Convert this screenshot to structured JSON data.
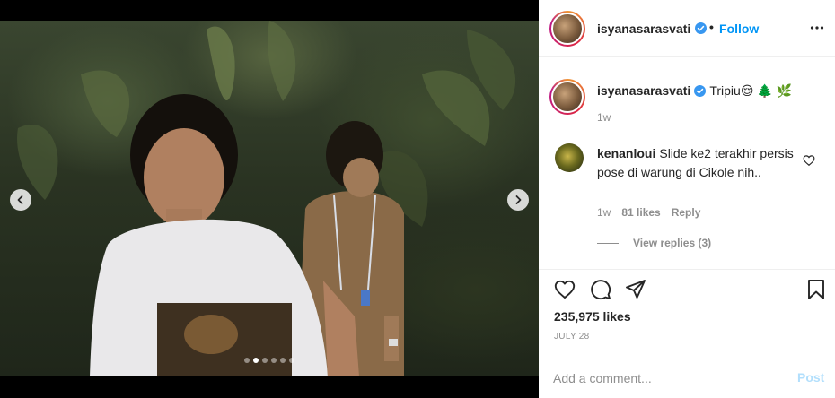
{
  "post": {
    "username": "isyanasarasvati",
    "header_sep": "•",
    "follow_label": "Follow",
    "caption_text": "Tripiu",
    "caption_emojis": "😌 🌲 🌿",
    "caption_time": "1w"
  },
  "comment": {
    "username": "kenanloui",
    "text": "Slide ke2 terakhir persis pose di warung di Cikole nih..",
    "time": "1w",
    "likes": "81 likes",
    "reply_label": "Reply",
    "view_replies": "View replies (3)"
  },
  "stats": {
    "likes": "235,975 likes",
    "date": "JULY 28"
  },
  "add_comment": {
    "placeholder": "Add a comment...",
    "post_label": "Post"
  },
  "carousel": {
    "slide_count": 6,
    "active_index": 1
  },
  "colors": {
    "link_blue": "#0095f6",
    "post_disabled": "#b2dffc",
    "muted_text": "#8e8e8e",
    "verified_blue": "#3897f0"
  },
  "icons": {
    "verified": "verified-badge-icon",
    "more": "more-options-icon",
    "like": "heart-icon",
    "comment": "comment-bubble-icon",
    "share": "paper-plane-icon",
    "save": "bookmark-icon",
    "prev": "chevron-left-icon",
    "next": "chevron-right-icon"
  }
}
